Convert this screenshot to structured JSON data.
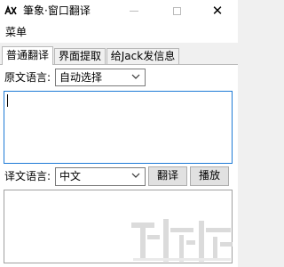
{
  "window": {
    "title": "筆象·窗口翻译",
    "icons": {
      "app": "app-logo-icon",
      "minimize": "minimize-icon",
      "maximize": "maximize-icon",
      "close": "close-icon"
    },
    "close_glyph": "✕"
  },
  "menu": {
    "items": [
      {
        "label": "菜单"
      }
    ]
  },
  "tabs": [
    {
      "label": "普通翻译",
      "active": true
    },
    {
      "label": "界面提取",
      "active": false
    },
    {
      "label": "给Jack发信息",
      "active": false
    }
  ],
  "source": {
    "label": "原文语言:",
    "language": "自动选择",
    "text": ""
  },
  "target": {
    "label": "译文语言:",
    "language": "中文",
    "text": ""
  },
  "buttons": {
    "translate": "翻译",
    "play": "播放"
  },
  "colors": {
    "accent_border": "#1e7bd6",
    "window_bg": "#f0f0f0"
  }
}
